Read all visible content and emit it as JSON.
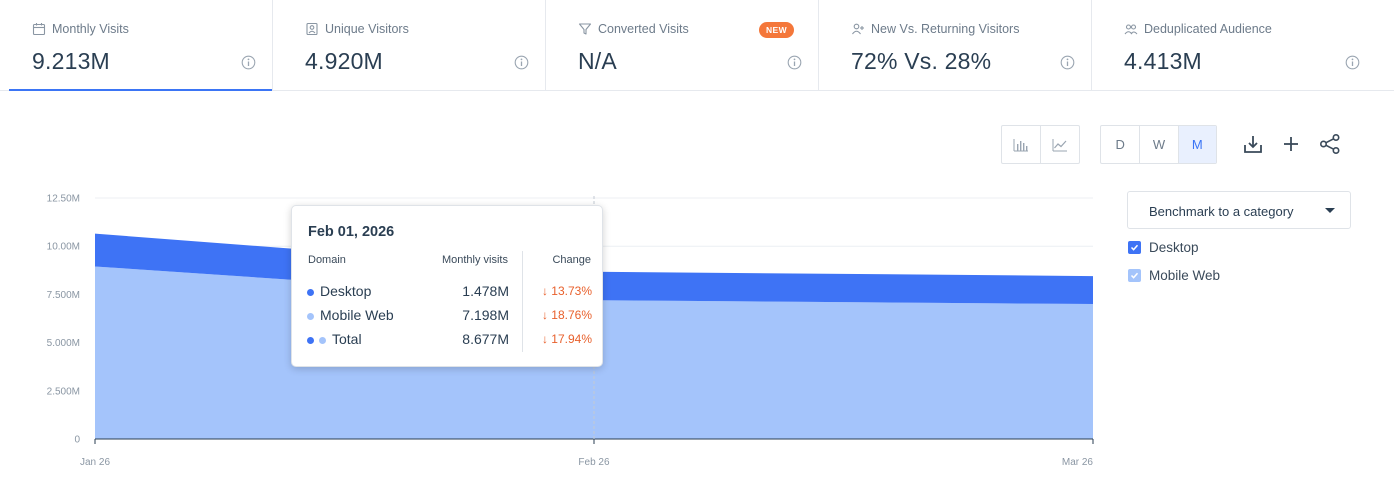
{
  "colors": {
    "accent": "#3b75f5",
    "desktop": "#3e73f5",
    "mobile_web": "#a4c4fb",
    "change_down": "#e8602c",
    "new_badge": "#f4773a"
  },
  "metrics": [
    {
      "label": "Monthly Visits",
      "value": "9.213M",
      "icon": "calendar-icon",
      "active": true
    },
    {
      "label": "Unique Visitors",
      "value": "4.920M",
      "icon": "person-card-icon"
    },
    {
      "label": "Converted Visits",
      "value": "N/A",
      "icon": "funnel-icon",
      "badge": "NEW"
    },
    {
      "label": "New Vs. Returning Visitors",
      "value": "72% Vs. 28%",
      "icon": "person-plus-icon"
    },
    {
      "label": "Deduplicated Audience",
      "value": "4.413M",
      "icon": "people-icon"
    }
  ],
  "toolbar": {
    "chart_types": [
      "bar-chart-icon",
      "line-chart-icon"
    ],
    "granularity": [
      "D",
      "W",
      "M"
    ],
    "granularity_selected": "M",
    "actions": [
      "download-icon",
      "plus-icon",
      "share-icon"
    ]
  },
  "benchmark": {
    "label": "Benchmark to a category"
  },
  "legend": [
    {
      "label": "Desktop",
      "checked": true
    },
    {
      "label": "Mobile Web",
      "checked": true
    }
  ],
  "chart_data": {
    "type": "area",
    "stacked": true,
    "categories": [
      "Jan 26",
      "Feb 26",
      "Mar 26"
    ],
    "y_tick_labels": [
      "0",
      "2.500M",
      "5.000M",
      "7.500M",
      "10.00M",
      "12.50M"
    ],
    "ylim": [
      0,
      12.5
    ],
    "grid": true,
    "series": [
      {
        "name": "Mobile Web",
        "values": [
          8.95,
          7.198,
          7.0
        ]
      },
      {
        "name": "Desktop",
        "values": [
          1.7,
          1.478,
          1.45
        ]
      }
    ],
    "hover_index": 1
  },
  "tooltip": {
    "date": "Feb 01, 2026",
    "headers": {
      "domain": "Domain",
      "visits": "Monthly visits",
      "change": "Change"
    },
    "rows": [
      {
        "name": "Desktop",
        "value": "1.478M",
        "change": "13.73%"
      },
      {
        "name": "Mobile Web",
        "value": "7.198M",
        "change": "18.76%"
      },
      {
        "name": "Total",
        "value": "8.677M",
        "change": "17.94%"
      }
    ]
  }
}
